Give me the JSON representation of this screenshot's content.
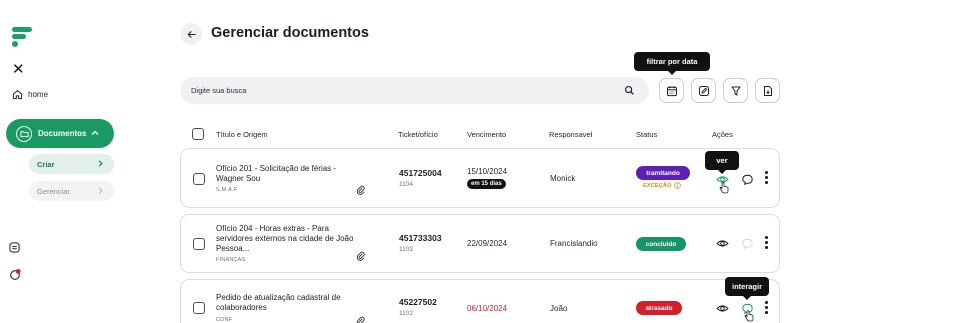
{
  "sidebar": {
    "home_label": "home",
    "documents_label": "Documentos",
    "criar_label": "Criar",
    "gerenciar_label": "Gerenciar"
  },
  "header": {
    "title": "Gerenciar documentos"
  },
  "tooltips": {
    "filter_date": "filtrar por data",
    "view": "ver",
    "interact": "interagir"
  },
  "search": {
    "placeholder": "Digite sua busca"
  },
  "table": {
    "columns": {
      "title": "Título e Origem",
      "ticket": "Ticket/ofício",
      "due": "Vencimento",
      "owner": "Responsavel",
      "status": "Status",
      "actions": "Ações"
    },
    "rows": [
      {
        "title": "Ofício 201 - Solicitação de férias - Wagner Sou",
        "origin": "S.M.A.F",
        "ticket": "451725004",
        "sub_ticket": "1104",
        "due": "15/10/2024",
        "due_pill": "em 15 dias",
        "owner": "Monick",
        "status": "tramitando",
        "status_note": "EXCEÇÃO",
        "status_color": "#5b21b6"
      },
      {
        "title": "Ofício 204 - Horas extras - Para servidores externos na cidade de João Pessoa...",
        "origin": "FINANÇAS",
        "ticket": "451733303",
        "sub_ticket": "1103",
        "due": "22/09/2024",
        "owner": "Francislandio",
        "status": "concluido",
        "status_color": "#16956a"
      },
      {
        "title": "Pedido de atualização cadastral de colaboradores",
        "origin": "CONF",
        "ticket": "45227502",
        "sub_ticket": "1102",
        "due": "06/10/2024",
        "owner": "João",
        "status": "atrasado",
        "status_color": "#d61f2c"
      }
    ]
  },
  "colors": {
    "brand": "#1a9a63",
    "overdue": "#d61f2c",
    "exception": "#e8800c"
  }
}
